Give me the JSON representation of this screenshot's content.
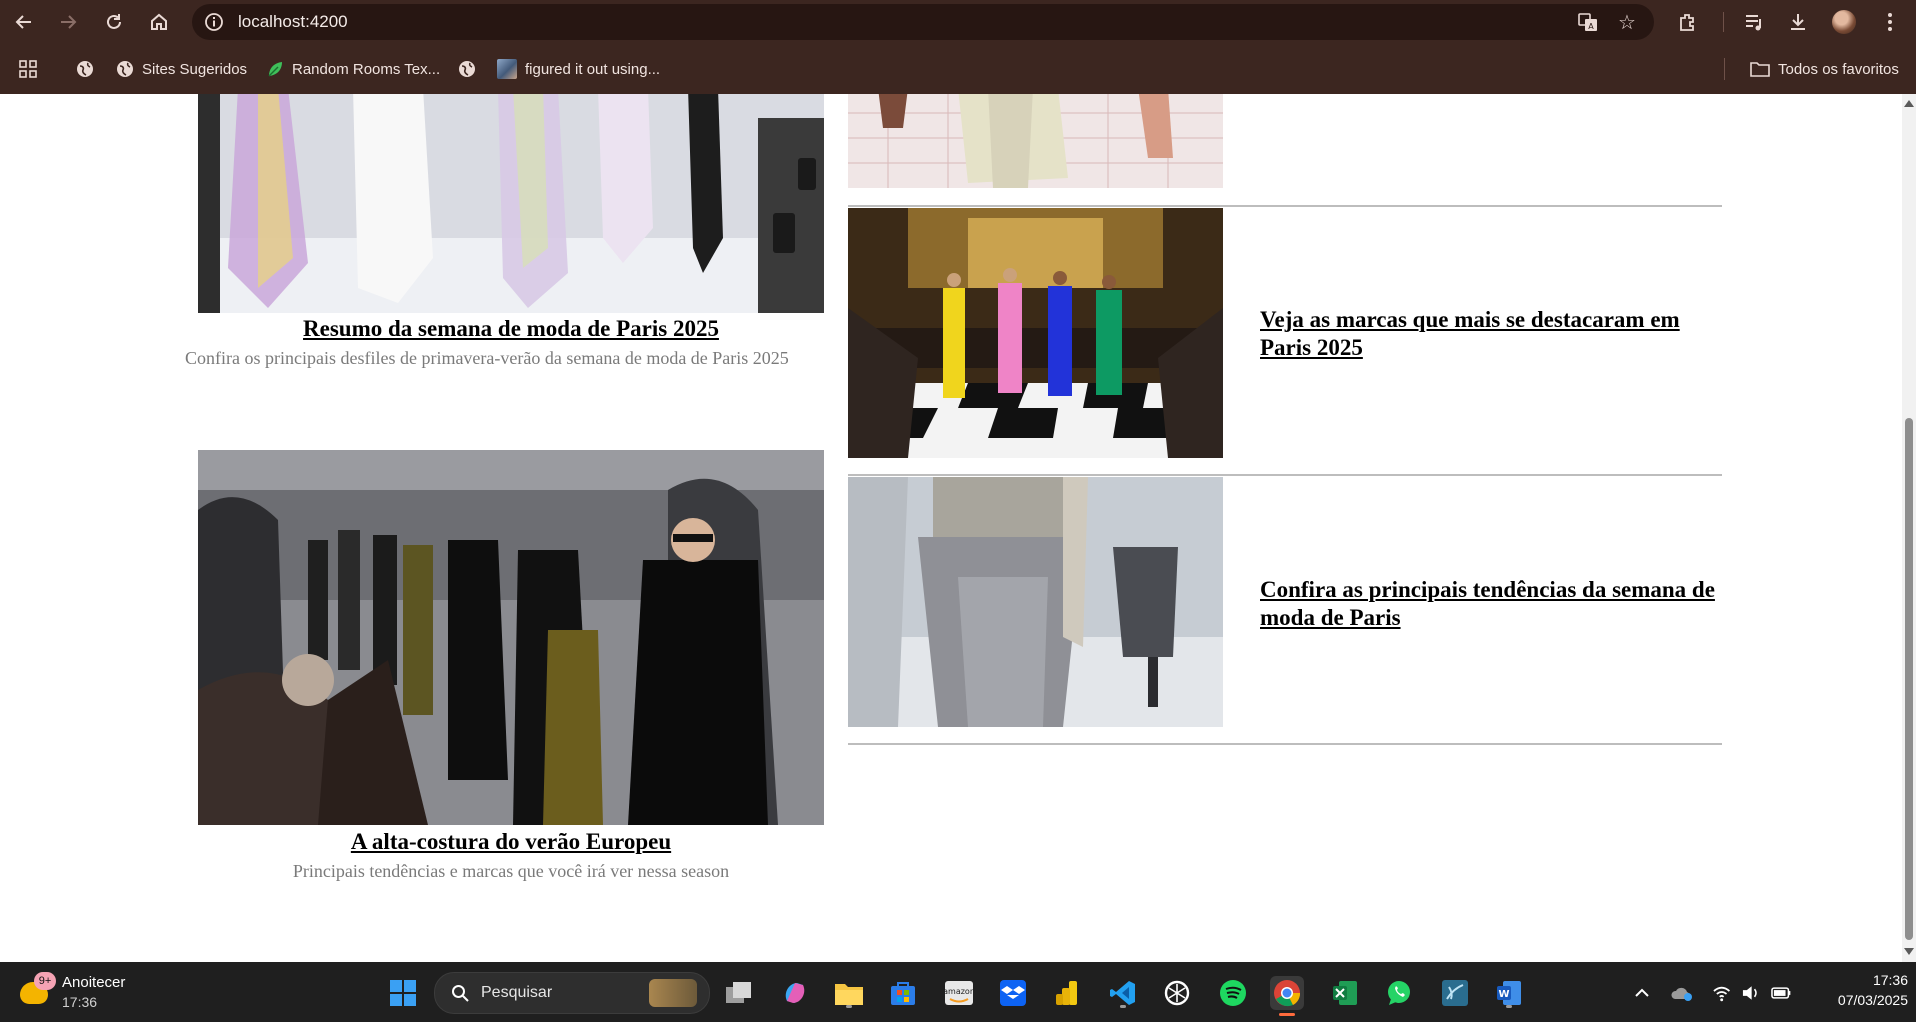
{
  "browser": {
    "url": "localhost:4200",
    "bookmarks": [
      {
        "label": "",
        "icon": "globe-icon"
      },
      {
        "label": "Sites Sugeridos",
        "icon": "globe-icon"
      },
      {
        "label": "Random Rooms Tex...",
        "icon": "leaf-icon"
      },
      {
        "label": "",
        "icon": "globe-icon"
      },
      {
        "label": "figured it out using...",
        "icon": "thumbnail-icon"
      }
    ],
    "favorites_label": "Todos os favoritos"
  },
  "page": {
    "left_cards": [
      {
        "title": "Resumo da semana de moda de Paris 2025",
        "description": "Confira os principais desfiles de primavera-verão da semana de moda de Paris 2025"
      },
      {
        "title": "A alta-costura do verão Europeu",
        "description": "Principais tendências e marcas que você irá ver nessa season"
      }
    ],
    "right_items": [
      {
        "title": "Veja as marcas que mais se destacaram em Paris 2025"
      },
      {
        "title": "Confira as principais tendências da semana de moda de Paris"
      }
    ]
  },
  "taskbar": {
    "weather_badge": "9+",
    "weather_title": "Anoitecer",
    "weather_time": "17:36",
    "search_placeholder": "Pesquisar",
    "clock_time": "17:36",
    "clock_date": "07/03/2025"
  },
  "colors": {
    "chrome_bg": "#3c2620",
    "omnibox_bg": "#271612",
    "taskbar_bg": "#1f1f1f",
    "description_text": "#7a7a7a"
  }
}
